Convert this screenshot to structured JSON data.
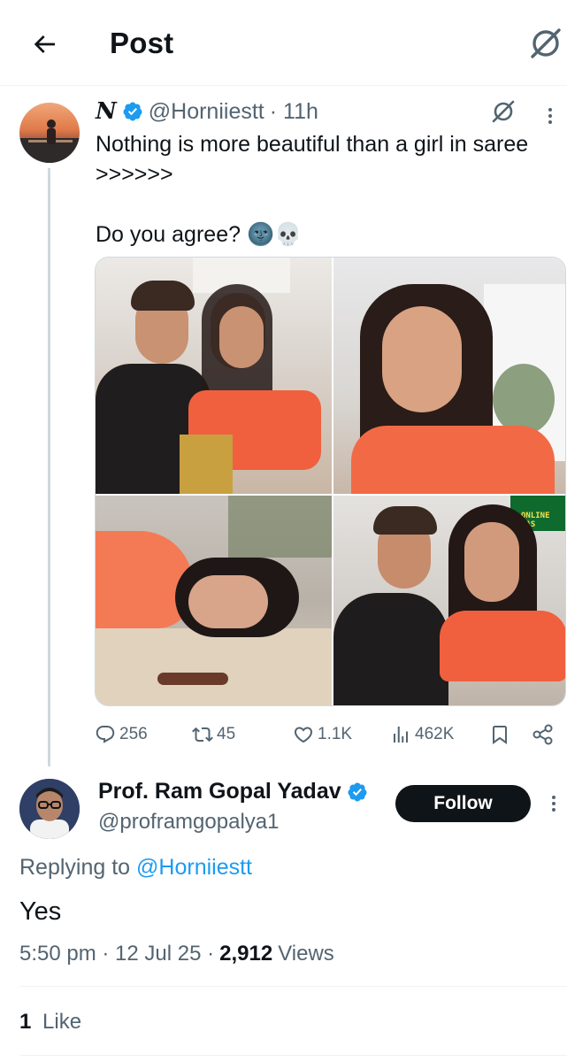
{
  "header": {
    "title": "Post",
    "back_icon": "arrow-left-icon",
    "grok_icon": "grok-icon"
  },
  "original_post": {
    "display_name": "N",
    "handle": "@Horniiestt",
    "age": "· 11h",
    "text": "Nothing is more beautiful than a girl in saree\n>>>>>>\n\nDo you agree? 🌚💀",
    "images": [
      "photo-couple-selfie",
      "photo-woman-portrait",
      "photo-woman-lying",
      "photo-couple-selfie-2"
    ],
    "image_overlay_text": "ONLINE CAS",
    "stats": {
      "replies": "256",
      "reposts": "45",
      "likes": "1.1K",
      "views": "462K"
    }
  },
  "reply": {
    "display_name": "Prof. Ram Gopal Yadav",
    "handle": "@proframgopalya1",
    "follow_label": "Follow",
    "replying_prefix": "Replying to",
    "replying_to": "@Horniiestt",
    "text": "Yes",
    "time": "5:50 pm · 12 Jul 25 ·",
    "views_count": "2,912",
    "views_label": "Views",
    "likes_count": "1",
    "likes_label": "Like"
  },
  "colors": {
    "accent": "#1d9bf0",
    "text": "#0f1419",
    "muted": "#536471",
    "verified": "#1d9bf0"
  }
}
